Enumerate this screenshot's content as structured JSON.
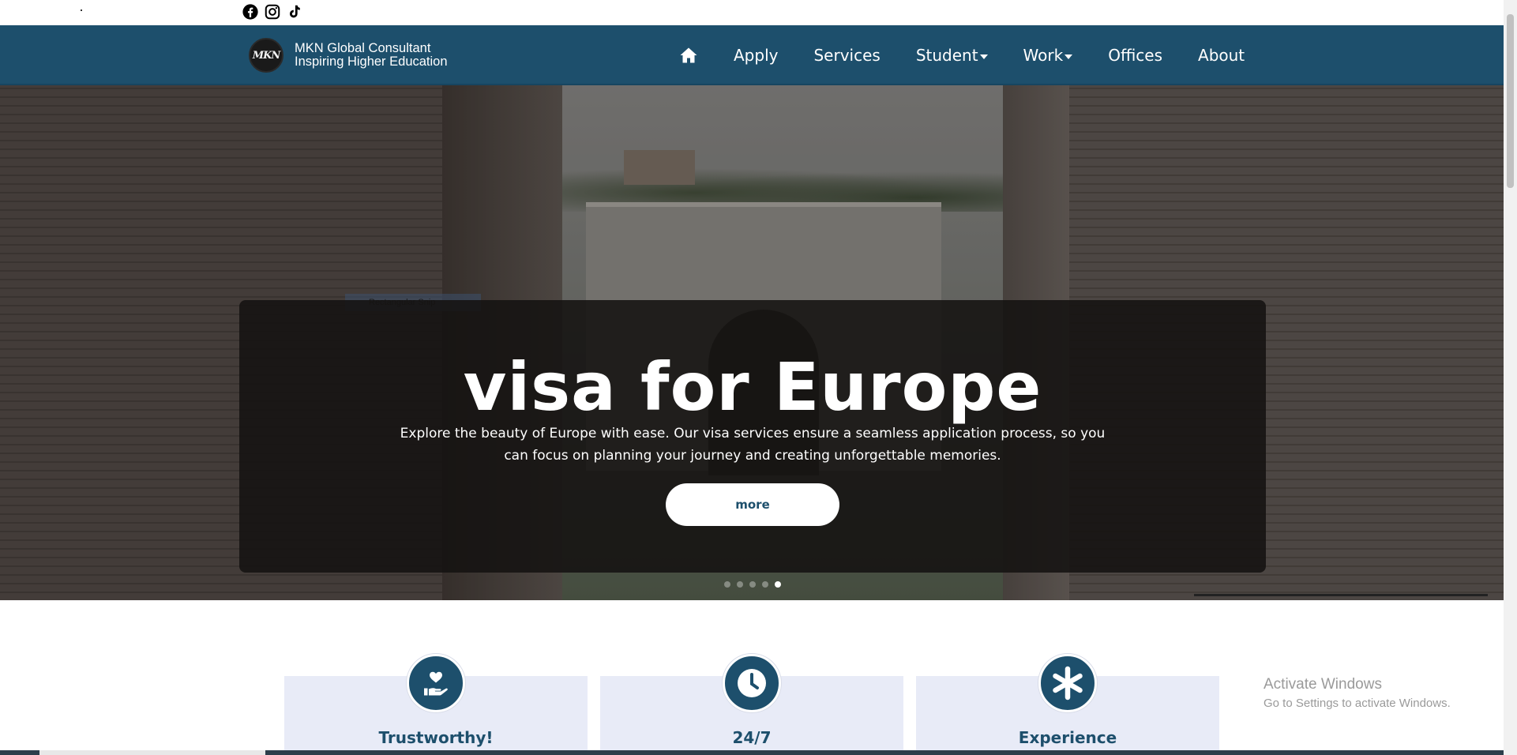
{
  "social": {
    "icons": [
      "facebook-icon",
      "instagram-icon",
      "tiktok-icon"
    ]
  },
  "brand": {
    "logo_text": "MKN",
    "name": "MKN Global Consultant",
    "tagline": "Inspiring Higher Education"
  },
  "nav": {
    "home_icon": "home-icon",
    "items": [
      {
        "label": "Apply",
        "dropdown": false
      },
      {
        "label": "Services",
        "dropdown": false
      },
      {
        "label": "Student",
        "dropdown": true
      },
      {
        "label": "Work",
        "dropdown": true
      },
      {
        "label": "Offices",
        "dropdown": false
      },
      {
        "label": "About",
        "dropdown": false
      }
    ]
  },
  "hero": {
    "snip_label": "Rectangular Snip",
    "title": "visa for Europe",
    "description": "Explore the beauty of Europe with ease. Our visa services ensure a seamless application process, so you can focus on planning your journey and creating unforgettable memories.",
    "button_label": "more",
    "slides_total": 5,
    "active_slide": 5
  },
  "features": [
    {
      "title": "Trustworthy!",
      "icon": "heart-hand-icon"
    },
    {
      "title": "24/7",
      "icon": "clock-icon"
    },
    {
      "title": "Experience",
      "icon": "asterisk-icon"
    }
  ],
  "watermark": {
    "line1": "Activate Windows",
    "line2": "Go to Settings to activate Windows."
  },
  "colors": {
    "primary": "#1d4f6c",
    "card_bg": "#e8ebf7",
    "caption_bg": "#141211"
  }
}
